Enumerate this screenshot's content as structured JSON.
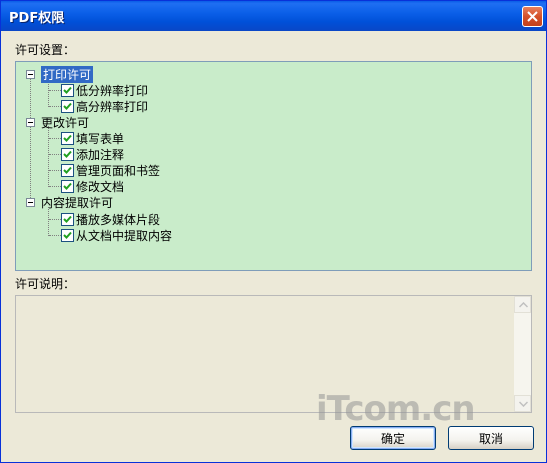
{
  "window": {
    "title": "PDF权限"
  },
  "permissions": {
    "label": "许可设置：",
    "groups": [
      {
        "label": "打印许可",
        "selected": true,
        "items": [
          {
            "label": "低分辨率打印",
            "checked": true
          },
          {
            "label": "高分辨率打印",
            "checked": true
          }
        ]
      },
      {
        "label": "更改许可",
        "selected": false,
        "items": [
          {
            "label": "填写表单",
            "checked": true
          },
          {
            "label": "添加注释",
            "checked": true
          },
          {
            "label": "管理页面和书签",
            "checked": true
          },
          {
            "label": "修改文档",
            "checked": true
          }
        ]
      },
      {
        "label": "内容提取许可",
        "selected": false,
        "items": [
          {
            "label": "播放多媒体片段",
            "checked": true
          },
          {
            "label": "从文档中提取内容",
            "checked": true
          }
        ]
      }
    ]
  },
  "description": {
    "label": "许可说明：",
    "text": ""
  },
  "buttons": {
    "ok": "确定",
    "cancel": "取消"
  },
  "watermark": "iTcom.cn",
  "colors": {
    "title_bar": "#0054e3",
    "tree_bg": "#c9ecca",
    "selection": "#316ac5",
    "dialog_bg": "#ece9d8"
  }
}
